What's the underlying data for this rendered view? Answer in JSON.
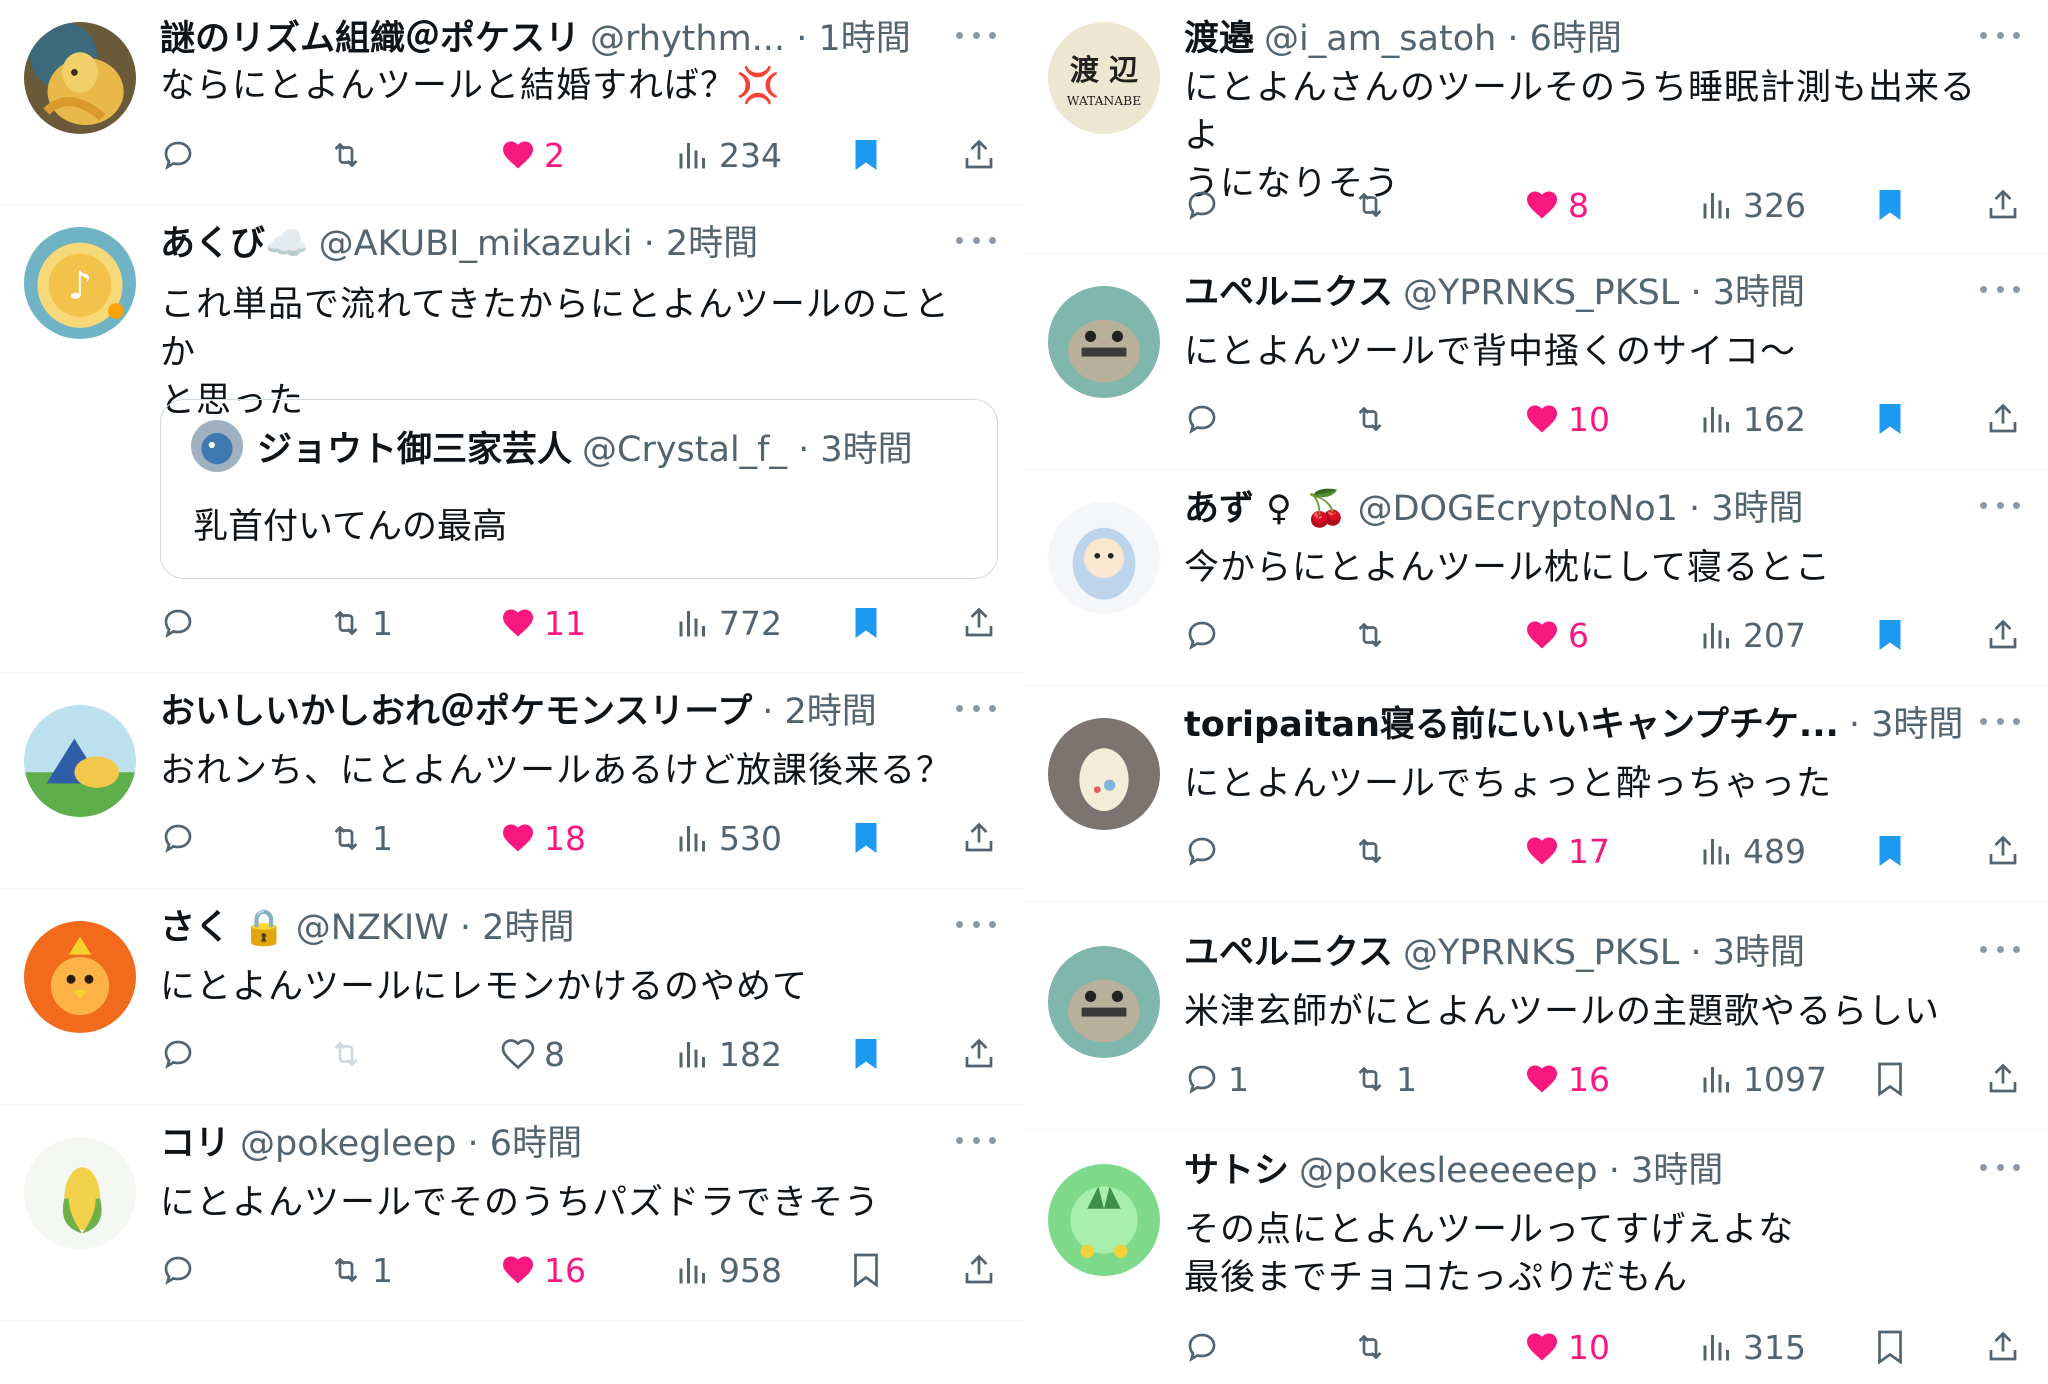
{
  "accent": {
    "like": "#f91880",
    "bookmark": "#1d9bf0",
    "muted": "#536471"
  },
  "icons": [
    "reply-icon",
    "retweet-icon",
    "like-icon",
    "views-icon",
    "bookmark-icon",
    "share-icon",
    "more-icon"
  ],
  "left": [
    {
      "name": "謎のリズム組織＠ポケスリ",
      "meta": "@rhythm... · 1時間",
      "lines": [
        "ならにとよんツールと結婚すれば？💢"
      ],
      "reply": "",
      "rt": "",
      "like": "2",
      "liked": true,
      "views": "234",
      "bookmarked": true
    },
    {
      "name": "あくび☁️",
      "meta": "@AKUBI_mikazuki · 2時間",
      "lines": [
        "これ単品で流れてきたからにとよんツールのことか",
        "と思った"
      ],
      "quote": {
        "name": "ジョウト御三家芸人",
        "meta": "@Crystal_f_ · 3時間",
        "text": "乳首付いてんの最高"
      },
      "reply": "",
      "rt": "1",
      "like": "11",
      "liked": true,
      "views": "772",
      "bookmarked": true
    },
    {
      "name": "おいしいかしおれ＠ポケモンスリープ",
      "meta": "· 2時間",
      "lines": [
        "おれンち、にとよんツールあるけど放課後来る？"
      ],
      "reply": "",
      "rt": "1",
      "like": "18",
      "liked": true,
      "views": "530",
      "bookmarked": true
    },
    {
      "name": "さく 🔒",
      "meta": "@NZKIW · 2時間",
      "lines": [
        "にとよんツールにレモンかけるのやめて"
      ],
      "reply": "",
      "rt": "",
      "like": "8",
      "liked": false,
      "views": "182",
      "bookmarked": true
    },
    {
      "name": "コリ",
      "meta": "@pokegleep · 6時間",
      "lines": [
        "にとよんツールでそのうちパズドラできそう"
      ],
      "reply": "",
      "rt": "1",
      "like": "16",
      "liked": true,
      "views": "958",
      "bookmarked": false
    }
  ],
  "right": [
    {
      "name": "渡邉",
      "meta": "@i_am_satoh · 6時間",
      "lines": [
        "にとよんさんのツールそのうち睡眠計測も出来るよ",
        "うになりそう"
      ],
      "reply": "",
      "rt": "",
      "like": "8",
      "liked": true,
      "views": "326",
      "bookmarked": true,
      "avatar_text": [
        "渡 辺",
        "WATANABE"
      ]
    },
    {
      "name": "ユペルニクス",
      "meta": "@YPRNKS_PKSL · 3時間",
      "lines": [
        "にとよんツールで背中掻くのサイコ〜"
      ],
      "reply": "",
      "rt": "",
      "like": "10",
      "liked": true,
      "views": "162",
      "bookmarked": true
    },
    {
      "name": "あず ♀ 🍒",
      "meta": "@DOGEcryptoNo1 · 3時間",
      "lines": [
        "今からにとよんツール枕にして寝るとこ"
      ],
      "reply": "",
      "rt": "",
      "like": "6",
      "liked": true,
      "views": "207",
      "bookmarked": true
    },
    {
      "name": "toripaitan寝る前にいいキャンプチケ...",
      "meta": "· 3時間",
      "lines": [
        "にとよんツールでちょっと酔っちゃった"
      ],
      "reply": "",
      "rt": "",
      "like": "17",
      "liked": true,
      "views": "489",
      "bookmarked": true
    },
    {
      "name": "ユペルニクス",
      "meta": "@YPRNKS_PKSL · 3時間",
      "lines": [
        "米津玄師がにとよんツールの主題歌やるらしい"
      ],
      "reply": "1",
      "rt": "1",
      "like": "16",
      "liked": true,
      "views": "1097",
      "bookmarked": false
    },
    {
      "name": "サトシ",
      "meta": "@pokesleeeeeep · 3時間",
      "lines": [
        "その点にとよんツールってすげえよな",
        "最後までチョコたっぷりだもん"
      ],
      "reply": "",
      "rt": "",
      "like": "10",
      "liked": true,
      "views": "315",
      "bookmarked": false
    }
  ]
}
